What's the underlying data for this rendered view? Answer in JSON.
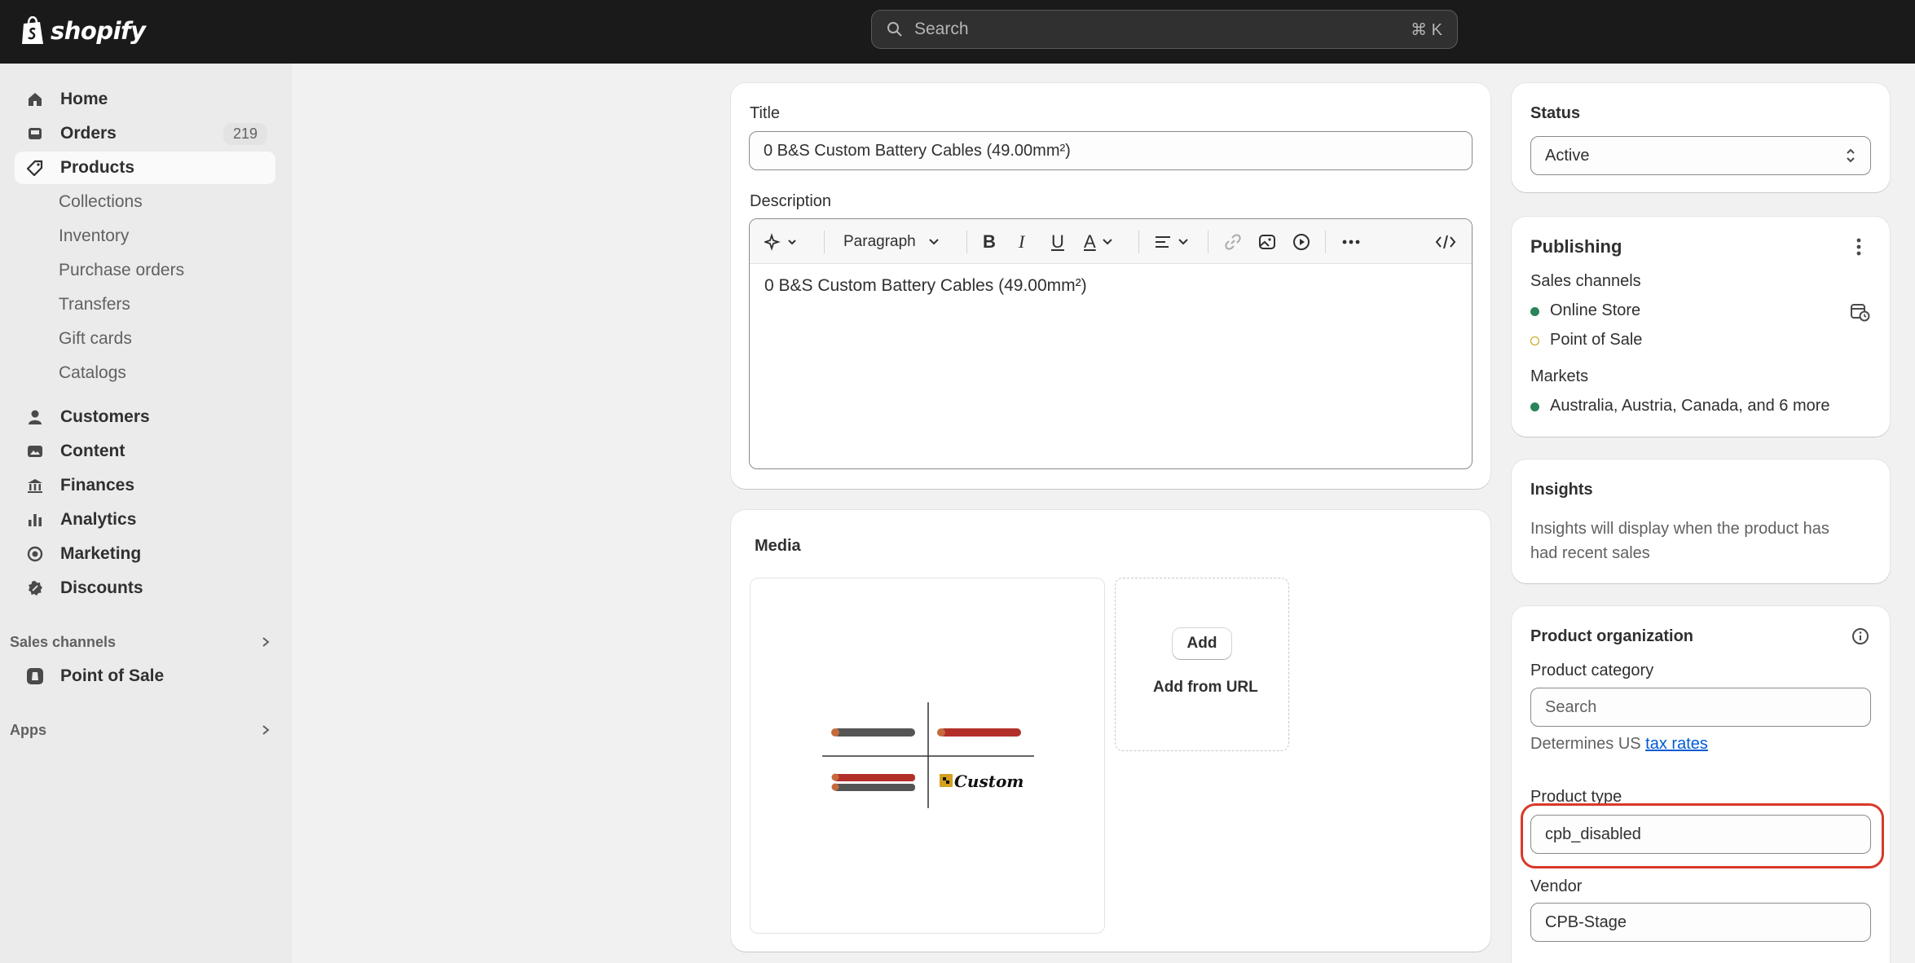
{
  "topbar": {
    "brand": "shopify",
    "search_placeholder": "Search",
    "search_shortcut": "⌘ K"
  },
  "sidebar": {
    "items": [
      {
        "label": "Home",
        "icon": "home-icon"
      },
      {
        "label": "Orders",
        "icon": "inbox-icon",
        "badge": "219"
      },
      {
        "label": "Products",
        "icon": "tag-icon",
        "active": true
      }
    ],
    "product_subitems": [
      "Collections",
      "Inventory",
      "Purchase orders",
      "Transfers",
      "Gift cards",
      "Catalogs"
    ],
    "items2": [
      {
        "label": "Customers",
        "icon": "person-icon"
      },
      {
        "label": "Content",
        "icon": "image-icon"
      },
      {
        "label": "Finances",
        "icon": "bank-icon"
      },
      {
        "label": "Analytics",
        "icon": "bar-chart-icon"
      },
      {
        "label": "Marketing",
        "icon": "target-icon"
      },
      {
        "label": "Discounts",
        "icon": "discount-icon"
      }
    ],
    "sales_channels_label": "Sales channels",
    "point_of_sale_label": "Point of Sale",
    "apps_label": "Apps"
  },
  "main": {
    "title_label": "Title",
    "title_value": "0 B&S Custom Battery Cables (49.00mm²)",
    "description_label": "Description",
    "paragraph_label": "Paragraph",
    "description_value": "0 B&S Custom Battery Cables (49.00mm²)",
    "media_heading": "Media",
    "add_button": "Add",
    "add_from_url": "Add from URL",
    "media_logo_text": "Custom"
  },
  "status": {
    "label": "Status",
    "value": "Active"
  },
  "publishing": {
    "heading": "Publishing",
    "sales_channels_label": "Sales channels",
    "channels": [
      {
        "name": "Online Store",
        "status_color": "#29845a"
      },
      {
        "name": "Point of Sale",
        "status_color": "#c4a000"
      }
    ],
    "markets_label": "Markets",
    "markets_value": "Australia, Austria, Canada, and 6 more"
  },
  "insights": {
    "heading": "Insights",
    "text_line1": "Insights will display when the product has",
    "text_line2": "had recent sales"
  },
  "organization": {
    "heading": "Product organization",
    "category_label": "Product category",
    "category_placeholder": "Search",
    "category_help_prefix": "Determines US",
    "category_help_link": "tax rates",
    "type_label": "Product type",
    "type_value": "cpb_disabled",
    "vendor_label": "Vendor",
    "vendor_value": "CPB-Stage"
  },
  "colors": {
    "topbar": "#1a1a1a",
    "highlight": "#d9382a",
    "link": "#005bd3"
  }
}
